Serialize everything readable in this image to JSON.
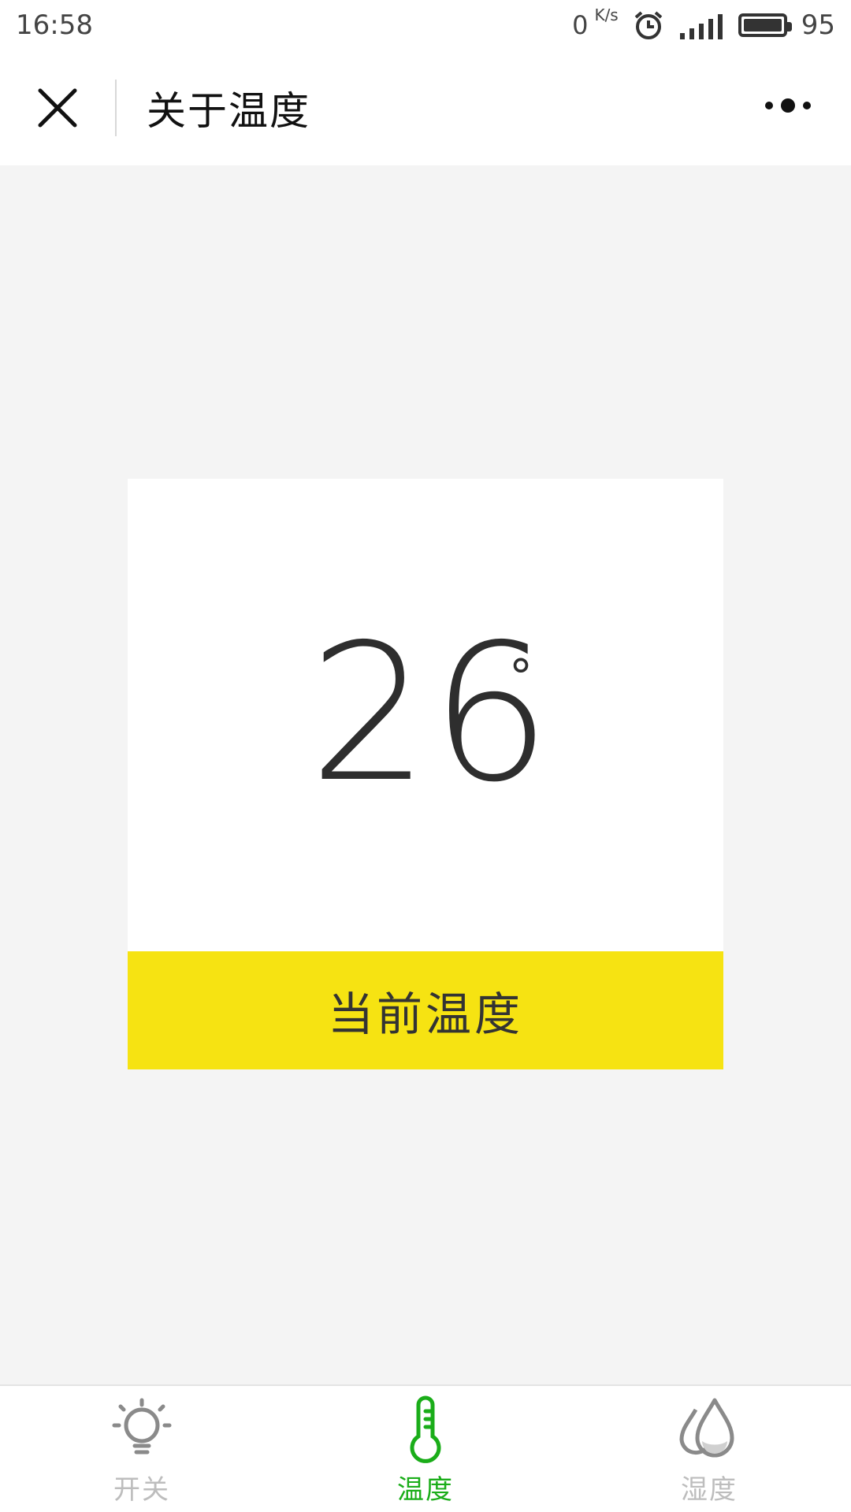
{
  "status_bar": {
    "time": "16:58",
    "net_speed": "0",
    "net_unit": "K/s",
    "network": "4G",
    "battery": "95"
  },
  "nav": {
    "title": "关于温度"
  },
  "card": {
    "temperature": "26",
    "unit": "°",
    "footer_label": "当前温度",
    "footer_color": "#f6e312"
  },
  "tabs": [
    {
      "label": "开关",
      "icon": "lightbulb-icon",
      "active": false
    },
    {
      "label": "温度",
      "icon": "thermometer-icon",
      "active": true
    },
    {
      "label": "湿度",
      "icon": "water-drops-icon",
      "active": false
    }
  ],
  "colors": {
    "active_tab": "#1aad19",
    "inactive_tab": "#bdbdbd"
  }
}
